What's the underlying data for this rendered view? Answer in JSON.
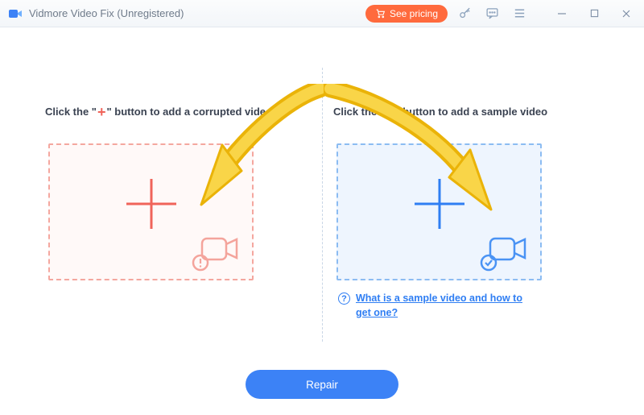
{
  "titlebar": {
    "app_title": "Vidmore Video Fix (Unregistered)",
    "see_pricing": "See pricing"
  },
  "left_pane": {
    "label_pre": "Click the \"",
    "label_post": "\" button to add a corrupted video",
    "plus_glyph": "+"
  },
  "right_pane": {
    "label_pre": "Click the \"",
    "label_post": "\" button to add a sample video",
    "plus_glyph": "+",
    "help_glyph": "?",
    "help_text": "What is a sample video and how to get one?"
  },
  "footer": {
    "repair_label": "Repair"
  }
}
